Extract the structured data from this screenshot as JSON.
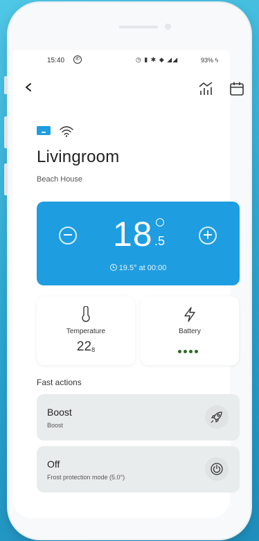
{
  "status_bar": {
    "time": "15:40",
    "battery": "93%"
  },
  "room": {
    "name": "Livingroom",
    "location": "Beach House"
  },
  "temperature_control": {
    "setpoint_whole": "18",
    "setpoint_decimal": ".5",
    "schedule_text": "19.5° at 00:00"
  },
  "info_cards": {
    "temperature": {
      "label": "Temperature",
      "value_whole": "22",
      "value_decimal": "8"
    },
    "battery": {
      "label": "Battery",
      "level_dots": 4
    }
  },
  "fast_actions": {
    "title": "Fast actions",
    "items": [
      {
        "title": "Boost",
        "description": "Boost",
        "icon": "rocket-icon"
      },
      {
        "title": "Off",
        "description": "Frost protection mode (5.0°)",
        "icon": "power-icon"
      }
    ]
  },
  "colors": {
    "accent": "#1e9de0",
    "battery_dots": "#2e6b2e",
    "background": "#2aa3cf"
  }
}
